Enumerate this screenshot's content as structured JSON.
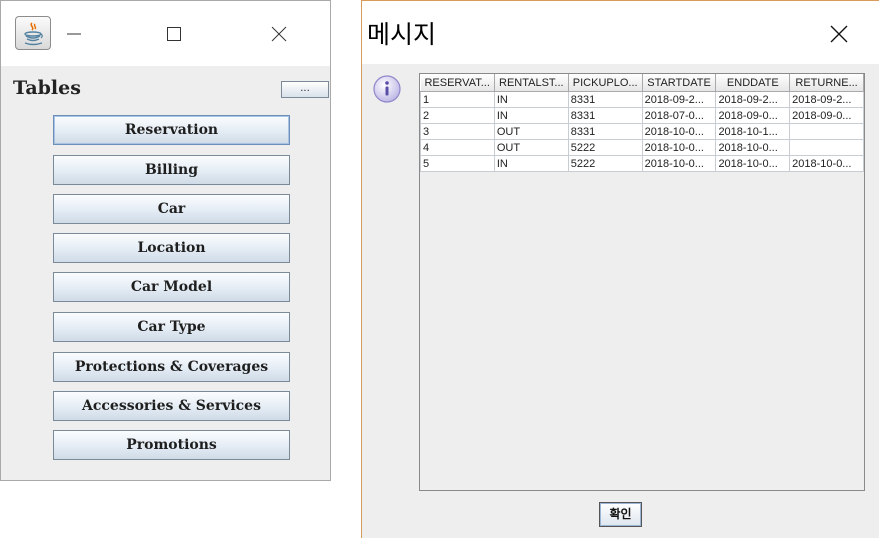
{
  "left_window": {
    "tables_label": "Tables",
    "more_button_label": "...",
    "buttons": [
      "Reservation",
      "Billing",
      "Car",
      "Location",
      "Car Model",
      "Car Type",
      "Protections & Coverages",
      "Accessories & Services",
      "Promotions"
    ]
  },
  "dialog": {
    "title": "메시지",
    "ok_label": "확인",
    "columns": [
      "RESERVAT...",
      "RENTALST...",
      "PICKUPLO...",
      "STARTDATE",
      "ENDDATE",
      "RETURNE..."
    ],
    "rows": [
      [
        "1",
        "IN",
        "8331",
        "2018-09-2...",
        "2018-09-2...",
        "2018-09-2..."
      ],
      [
        "2",
        "IN",
        "8331",
        "2018-07-0...",
        "2018-09-0...",
        "2018-09-0..."
      ],
      [
        "3",
        "OUT",
        "8331",
        "2018-10-0...",
        "2018-10-1...",
        ""
      ],
      [
        "4",
        "OUT",
        "5222",
        "2018-10-0...",
        "2018-10-0...",
        ""
      ],
      [
        "5",
        "IN",
        "5222",
        "2018-10-0...",
        "2018-10-0...",
        "2018-10-0..."
      ]
    ]
  },
  "icons": {
    "app": "java-coffee-icon",
    "minimize": "minimize-icon",
    "maximize": "maximize-icon",
    "close": "close-icon",
    "info": "info-icon"
  },
  "colors": {
    "dialog_border": "#d89b5a",
    "button_gradient_top": "#fbfdff",
    "button_gradient_bottom": "#cfdbe7",
    "info_icon": "#8f86c9"
  }
}
